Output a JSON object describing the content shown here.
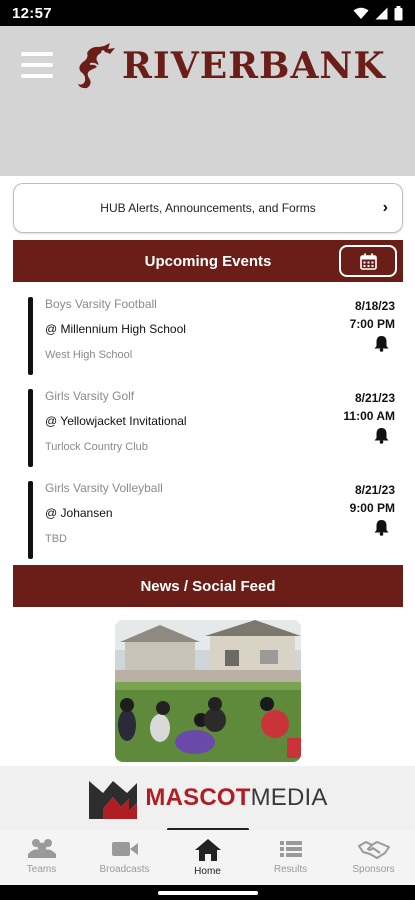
{
  "status_bar": {
    "time": "12:57"
  },
  "brand": {
    "name": "RIVERBANK"
  },
  "hub_alerts": {
    "label": "HUB Alerts, Announcements, and Forms"
  },
  "upcoming": {
    "title": "Upcoming Events",
    "events": [
      {
        "sport": "Boys Varsity Football",
        "opponent": "@ Millennium High School",
        "venue": "West High School",
        "date": "8/18/23",
        "time": "7:00 PM"
      },
      {
        "sport": "Girls Varsity Golf",
        "opponent": "@ Yellowjacket Invitational",
        "venue": "Turlock Country Club",
        "date": "8/21/23",
        "time": "11:00 AM"
      },
      {
        "sport": "Girls Varsity Volleyball",
        "opponent": "@ Johansen",
        "venue": "TBD",
        "date": "8/21/23",
        "time": "9:00 PM"
      }
    ]
  },
  "news": {
    "title": "News / Social Feed"
  },
  "sponsor": {
    "word1": "MASCOT",
    "word2": "MEDIA"
  },
  "tabs": [
    {
      "label": "Teams",
      "icon": "teams-icon"
    },
    {
      "label": "Broadcasts",
      "icon": "video-camera-icon"
    },
    {
      "label": "Home",
      "icon": "home-icon"
    },
    {
      "label": "Results",
      "icon": "list-icon"
    },
    {
      "label": "Sponsors",
      "icon": "handshake-icon"
    }
  ],
  "colors": {
    "brand": "#6b1e18",
    "header_bg": "#d4d4d4",
    "mascot_red": "#b01e23"
  }
}
